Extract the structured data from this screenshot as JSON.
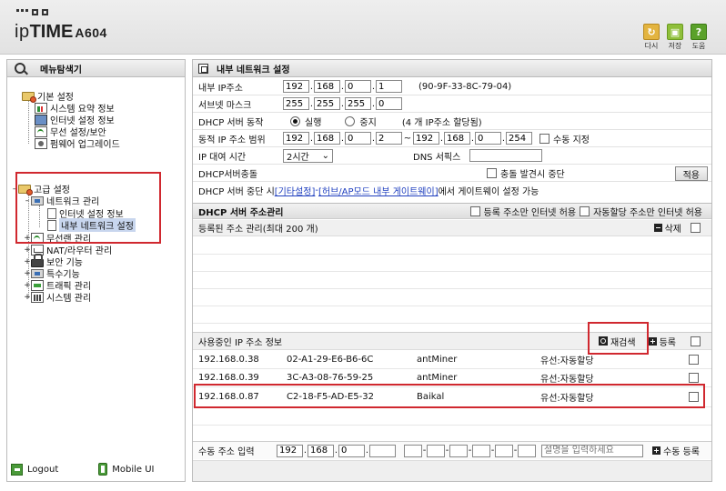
{
  "header": {
    "brand_prefix": "ip",
    "brand_bold": "TIME",
    "model": "A604",
    "buttons": [
      {
        "label": "다시",
        "icon": "redo-icon"
      },
      {
        "label": "저장",
        "icon": "save-icon"
      },
      {
        "label": "도움",
        "icon": "help-icon"
      }
    ]
  },
  "sidebar": {
    "title": "메뉴탐색기",
    "basic": {
      "label": "기본 설정",
      "items": [
        "시스템 요약 정보",
        "인터넷 설정 정보",
        "무선 설정/보안",
        "펌웨어 업그레이드"
      ]
    },
    "advanced": {
      "label": "고급 설정",
      "network": {
        "label": "네트워크 관리",
        "items": [
          "인터넷 설정 정보",
          "내부 네트워크 설정"
        ]
      },
      "items": [
        "무선랜 관리",
        "NAT/라우터 관리",
        "보안 기능",
        "특수기능",
        "트래픽 관리",
        "시스템 관리"
      ]
    },
    "footer": {
      "logout": "Logout",
      "mobile": "Mobile UI"
    }
  },
  "main": {
    "title": "내부 네트워크 설정",
    "lan_ip": {
      "label": "내부 IP주소",
      "octets": [
        "192",
        "168",
        "0",
        "1"
      ],
      "mac": "(90-9F-33-8C-79-04)"
    },
    "subnet": {
      "label": "서브넷 마스크",
      "octets": [
        "255",
        "255",
        "255",
        "0"
      ]
    },
    "dhcp_server": {
      "label": "DHCP 서버 동작",
      "on_label": "실행",
      "off_label": "중지",
      "status": "(4 개 IP주소 할당됨)"
    },
    "dynamic_range": {
      "label": "동적 IP 주소 범위",
      "start": [
        "192",
        "168",
        "0",
        "2"
      ],
      "tilde": "~",
      "end": [
        "192",
        "168",
        "0",
        "254"
      ],
      "manual_label": "수동 지정"
    },
    "lease": {
      "label": "IP 대여 시간",
      "value": "2시간",
      "dns_label": "DNS 서픽스",
      "dns_value": ""
    },
    "conflict": {
      "label": "DHCP서버충돌",
      "check_label": "충돌 발견시 중단",
      "apply": "적용"
    },
    "dhcp_stop_note": {
      "prefix": "DHCP 서버 중단 시 ",
      "link1": "[기타설정]",
      "mid": " - ",
      "link2": "[허브/AP모드 내부 게이트웨이]",
      "suffix": " 에서 게이트웨이 설정 가능"
    },
    "dhcp_manage": {
      "title": "DHCP 서버 주소관리",
      "opt1": "등록 주소만 인터넷 허용",
      "opt2": "자동할당 주소만 인터넷 허용",
      "registered_label": "등록된 주소 관리(최대 200 개)",
      "delete": "삭제"
    },
    "inuse": {
      "label": "사용중인 IP 주소 정보",
      "rescan": "재검색",
      "register": "등록",
      "rows": [
        {
          "ip": "192.168.0.38",
          "mac": "02-A1-29-E6-B6-6C",
          "name": "antMiner",
          "type": "유선:자동할당"
        },
        {
          "ip": "192.168.0.39",
          "mac": "3C-A3-08-76-59-25",
          "name": "antMiner",
          "type": "유선:자동할당"
        },
        {
          "ip": "192.168.0.87",
          "mac": "C2-18-F5-AD-E5-32",
          "name": "Baikal",
          "type": "유선:자동할당"
        }
      ]
    },
    "manual": {
      "label": "수동 주소 입력",
      "ip": [
        "192",
        "168",
        "0",
        ""
      ],
      "mac": [
        "",
        "",
        "",
        "",
        "",
        ""
      ],
      "desc_placeholder": "설명을 입력하세요",
      "register": "수동 등록"
    }
  }
}
